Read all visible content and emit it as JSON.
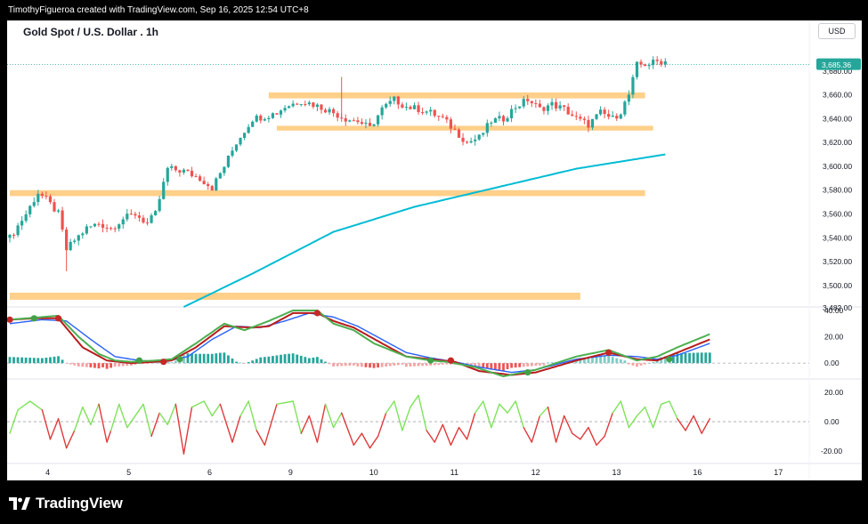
{
  "header": {
    "credit": "TimothyFigueroa created with TradingView.com, Sep 16, 2025 12:54 UTC+8"
  },
  "chart": {
    "title": "Gold Spot / U.S. Dollar . 1h",
    "currency": "USD",
    "last_price": "3,685.36"
  },
  "footer": {
    "logo_text": "TradingView"
  },
  "colors": {
    "up": "#26a69a",
    "down": "#ef5350",
    "zone": "#ffd08a",
    "ma": "#00bcd4",
    "green_line": "#4caf50",
    "red_line": "#b71c1c",
    "blue_line": "#2962ff",
    "osc_up": "#7ee35a",
    "osc_down": "#e03a3a"
  },
  "chart_data": [
    {
      "type": "candlestick",
      "title": "Gold Spot / U.S. Dollar . 1h",
      "x_ticks": [
        "4",
        "5",
        "6",
        "9",
        "10",
        "11",
        "12",
        "13",
        "16",
        "17"
      ],
      "x_tick_index": [
        4,
        24,
        44,
        64,
        84,
        104,
        124,
        144,
        164,
        184
      ],
      "y_ticks": [
        "3,500.00",
        "3,520.00",
        "3,540.00",
        "3,560.00",
        "3,580.00",
        "3,600.00",
        "3,620.00",
        "3,640.00",
        "3,660.00",
        "3,680.00"
      ],
      "ylim": [
        3482,
        3700
      ],
      "y_extra_label": "3,482.00",
      "last_price": 3685.36,
      "anchors": [
        [
          0,
          3540
        ],
        [
          4,
          3560
        ],
        [
          7,
          3578
        ],
        [
          9,
          3572
        ],
        [
          12,
          3560
        ],
        [
          14,
          3530
        ],
        [
          16,
          3538
        ],
        [
          19,
          3548
        ],
        [
          22,
          3552
        ],
        [
          25,
          3548
        ],
        [
          28,
          3556
        ],
        [
          31,
          3560
        ],
        [
          34,
          3552
        ],
        [
          36,
          3560
        ],
        [
          39,
          3598
        ],
        [
          43,
          3596
        ],
        [
          47,
          3590
        ],
        [
          50,
          3582
        ],
        [
          53,
          3600
        ],
        [
          56,
          3620
        ],
        [
          60,
          3640
        ],
        [
          63,
          3642
        ],
        [
          66,
          3645
        ],
        [
          68,
          3650
        ],
        [
          72,
          3655
        ],
        [
          75,
          3652
        ],
        [
          78,
          3648
        ],
        [
          80,
          3645
        ],
        [
          83,
          3640
        ],
        [
          86,
          3638
        ],
        [
          89,
          3632
        ],
        [
          92,
          3648
        ],
        [
          95,
          3656
        ],
        [
          98,
          3650
        ],
        [
          101,
          3648
        ],
        [
          104,
          3645
        ],
        [
          107,
          3640
        ],
        [
          110,
          3630
        ],
        [
          113,
          3620
        ],
        [
          116,
          3624
        ],
        [
          119,
          3638
        ],
        [
          122,
          3640
        ],
        [
          125,
          3650
        ],
        [
          128,
          3656
        ],
        [
          131,
          3648
        ],
        [
          134,
          3652
        ],
        [
          137,
          3648
        ],
        [
          140,
          3640
        ],
        [
          143,
          3635
        ],
        [
          146,
          3645
        ],
        [
          149,
          3640
        ],
        [
          151,
          3646
        ],
        [
          153,
          3660
        ],
        [
          155,
          3685
        ],
        [
          158,
          3686
        ],
        [
          160,
          3688
        ],
        [
          162,
          3688
        ]
      ],
      "moving_average": [
        [
          43,
          3482
        ],
        [
          60,
          3510
        ],
        [
          80,
          3545
        ],
        [
          100,
          3566
        ],
        [
          120,
          3582
        ],
        [
          140,
          3598
        ],
        [
          162,
          3610
        ]
      ],
      "zones": [
        {
          "x1": 64,
          "x2": 157,
          "y1": 3657,
          "y2": 3662
        },
        {
          "x1": 66,
          "x2": 159,
          "y1": 3630,
          "y2": 3634
        },
        {
          "x1": 0,
          "x2": 157,
          "y1": 3575,
          "y2": 3580
        },
        {
          "x1": 0,
          "x2": 141,
          "y1": 3488,
          "y2": 3494
        }
      ]
    },
    {
      "type": "line",
      "name": "momentum-panel",
      "y_ticks": [
        "40.00",
        "20.00",
        "0.00"
      ],
      "ylim": [
        -10,
        42
      ],
      "green_line": [
        [
          0,
          33
        ],
        [
          4,
          34
        ],
        [
          12,
          36
        ],
        [
          17,
          20
        ],
        [
          22,
          7
        ],
        [
          26,
          2
        ],
        [
          30,
          1
        ],
        [
          36,
          2
        ],
        [
          40,
          3
        ],
        [
          46,
          15
        ],
        [
          53,
          30
        ],
        [
          58,
          25
        ],
        [
          64,
          32
        ],
        [
          70,
          40
        ],
        [
          76,
          40
        ],
        [
          80,
          30
        ],
        [
          85,
          25
        ],
        [
          90,
          15
        ],
        [
          98,
          5
        ],
        [
          104,
          2
        ],
        [
          108,
          1
        ],
        [
          115,
          -3
        ],
        [
          122,
          -10
        ],
        [
          130,
          -5
        ],
        [
          140,
          5
        ],
        [
          148,
          10
        ],
        [
          155,
          2
        ],
        [
          160,
          5
        ],
        [
          165,
          12
        ],
        [
          173,
          22
        ]
      ],
      "red_line": [
        [
          0,
          33
        ],
        [
          6,
          34
        ],
        [
          12,
          34
        ],
        [
          18,
          12
        ],
        [
          24,
          2
        ],
        [
          30,
          0
        ],
        [
          36,
          1
        ],
        [
          40,
          2
        ],
        [
          46,
          12
        ],
        [
          53,
          28
        ],
        [
          60,
          27
        ],
        [
          64,
          28
        ],
        [
          70,
          38
        ],
        [
          76,
          38
        ],
        [
          80,
          32
        ],
        [
          85,
          27
        ],
        [
          92,
          15
        ],
        [
          98,
          5
        ],
        [
          104,
          3
        ],
        [
          110,
          1
        ],
        [
          116,
          -6
        ],
        [
          124,
          -9
        ],
        [
          130,
          -7
        ],
        [
          140,
          2
        ],
        [
          148,
          8
        ],
        [
          155,
          3
        ],
        [
          160,
          2
        ],
        [
          165,
          8
        ],
        [
          173,
          18
        ]
      ],
      "blue_line": [
        [
          0,
          30
        ],
        [
          8,
          33
        ],
        [
          14,
          32
        ],
        [
          20,
          18
        ],
        [
          26,
          5
        ],
        [
          32,
          2
        ],
        [
          38,
          1
        ],
        [
          44,
          5
        ],
        [
          50,
          18
        ],
        [
          56,
          28
        ],
        [
          62,
          27
        ],
        [
          68,
          32
        ],
        [
          74,
          38
        ],
        [
          80,
          35
        ],
        [
          86,
          28
        ],
        [
          92,
          18
        ],
        [
          98,
          8
        ],
        [
          104,
          4
        ],
        [
          110,
          1
        ],
        [
          116,
          -3
        ],
        [
          124,
          -7
        ],
        [
          130,
          -5
        ],
        [
          140,
          3
        ],
        [
          148,
          6
        ],
        [
          155,
          5
        ],
        [
          160,
          3
        ],
        [
          165,
          6
        ],
        [
          173,
          15
        ]
      ],
      "markers": [
        {
          "x": 0,
          "y": 33,
          "color": "red"
        },
        {
          "x": 6,
          "y": 34,
          "color": "green"
        },
        {
          "x": 12,
          "y": 34,
          "color": "red"
        },
        {
          "x": 32,
          "y": 2,
          "color": "green"
        },
        {
          "x": 38,
          "y": 1,
          "color": "red"
        },
        {
          "x": 42,
          "y": 3,
          "color": "green"
        },
        {
          "x": 76,
          "y": 38,
          "color": "red"
        },
        {
          "x": 104,
          "y": 2,
          "color": "green"
        },
        {
          "x": 109,
          "y": 2,
          "color": "red"
        },
        {
          "x": 128,
          "y": -7,
          "color": "green"
        },
        {
          "x": 148,
          "y": 8,
          "color": "red"
        },
        {
          "x": 163,
          "y": 3,
          "color": "green"
        }
      ]
    },
    {
      "type": "line",
      "name": "oscillator-panel",
      "y_ticks": [
        "20.00",
        "0.00",
        "-20.00"
      ],
      "ylim": [
        -28,
        28
      ],
      "zero_line": 0
    }
  ]
}
